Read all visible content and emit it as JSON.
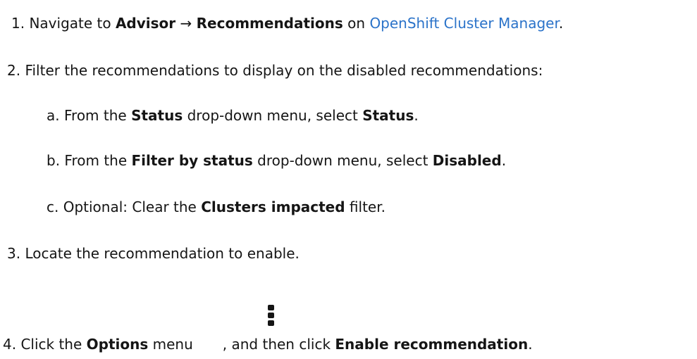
{
  "steps": [
    {
      "number": "1.",
      "pre": "Navigate to ",
      "bold1": "Advisor",
      "arrow": " → ",
      "bold2": "Recommendations",
      "mid": " on ",
      "link": "OpenShift Cluster Manager",
      "post": "."
    },
    {
      "number": "2.",
      "text": "Filter the recommendations to display on the disabled recommendations:"
    },
    {
      "number": "3.",
      "text": "Locate the recommendation to enable."
    },
    {
      "number": "4.",
      "pre": "Click the ",
      "bold1": "Options",
      "mid": " menu",
      "mid2": ", and then click ",
      "bold2": "Enable recommendation",
      "post": "."
    }
  ],
  "substeps": [
    {
      "letter": "a.",
      "pre": "From the ",
      "bold1": "Status",
      "mid": " drop-down menu, select ",
      "bold2": "Status",
      "post": "."
    },
    {
      "letter": "b.",
      "pre": "From the ",
      "bold1": "Filter by status",
      "mid": " drop-down menu, select ",
      "bold2": "Disabled",
      "post": "."
    },
    {
      "letter": "c.",
      "pre": "Optional: Clear the ",
      "bold1": "Clusters impacted",
      "post": " filter."
    }
  ],
  "icons": {
    "options_menu": "kebab-vertical-icon"
  },
  "colors": {
    "text": "#151515",
    "link": "#2b73c9"
  }
}
